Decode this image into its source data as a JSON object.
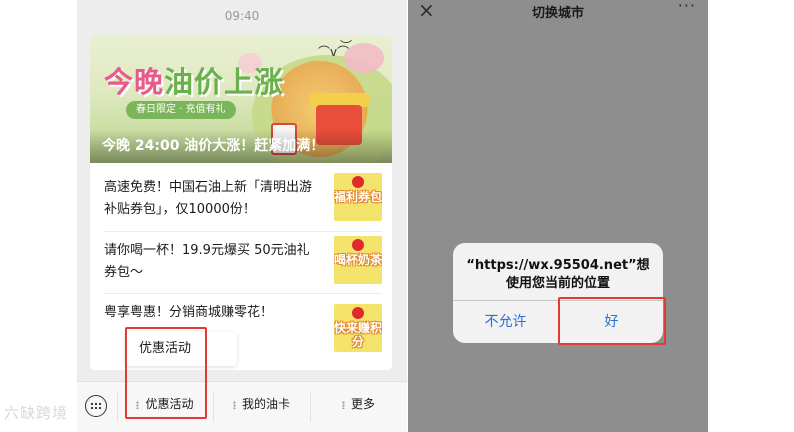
{
  "left_screen": {
    "time": "09:40",
    "banner": {
      "headline_part1": "今晚",
      "headline_part2": "油价上涨",
      "pill": "春日限定 · 充值有礼",
      "caption": "今晚 24:00 油价大涨！赶紧加满！"
    },
    "articles": [
      {
        "title": "高速免费！中国石油上新「清明出游补贴券包」，仅10000份！",
        "thumb_label": "福利券包"
      },
      {
        "title": "请你喝一杯！19.9元爆买 50元油礼券包～",
        "thumb_label": "喝杯奶茶"
      },
      {
        "title": "粤享粤惠！分销商城赚零花！",
        "thumb_label": "快来赚积分"
      }
    ],
    "popup_label": "优惠活动",
    "menu": [
      {
        "label": "优惠活动"
      },
      {
        "label": "我的油卡"
      },
      {
        "label": "更多"
      }
    ],
    "watermark": "六缺跨境",
    "highlight_color": "#e53935"
  },
  "right_screen": {
    "title": "切换城市",
    "dialog": {
      "message": "“https://wx.95504.net”想使用您当前的位置",
      "deny_label": "不允许",
      "allow_label": "好"
    },
    "accent_color": "#2a6fd6"
  }
}
